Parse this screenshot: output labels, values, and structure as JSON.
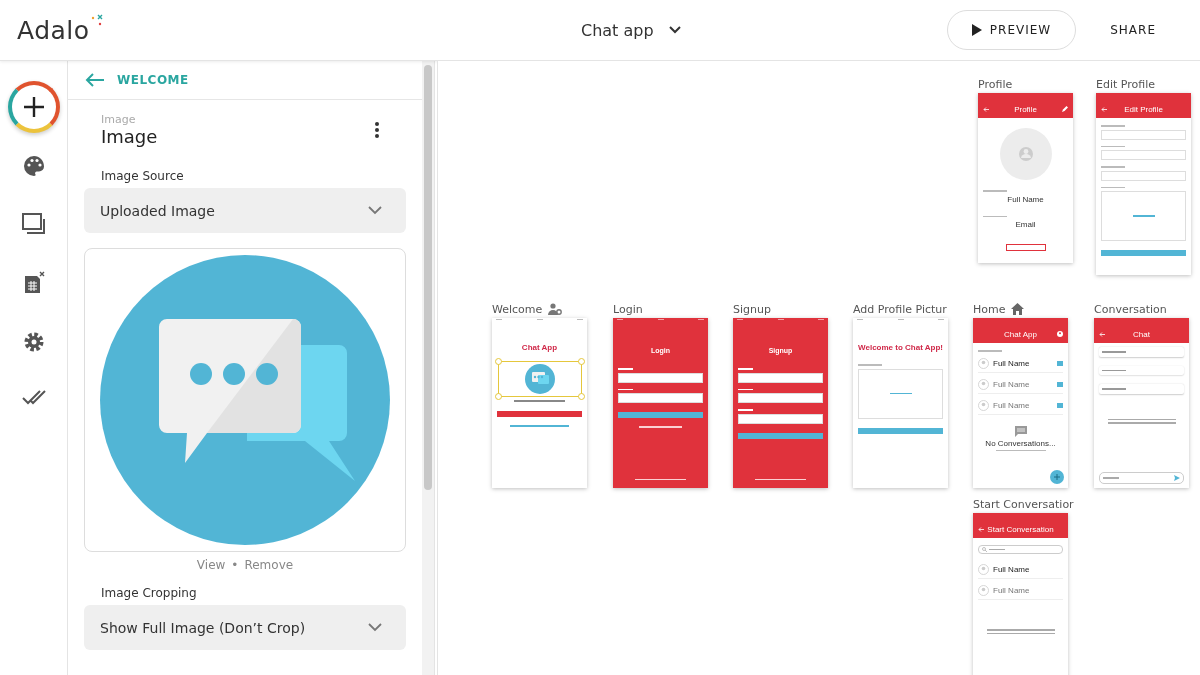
{
  "header": {
    "logo": "Adalo",
    "app_name": "Chat app",
    "preview": "PREVIEW",
    "share": "SHARE"
  },
  "panel": {
    "back": "WELCOME",
    "component_type": "Image",
    "component_name": "Image",
    "fields": [
      {
        "label": "Image Source",
        "value": "Uploaded Image"
      },
      {
        "label": "Image Cropping",
        "value": "Show Full Image (Don’t Crop)"
      }
    ],
    "image_links": [
      "View",
      "•",
      "Remove"
    ]
  },
  "screens": [
    {
      "title": "Profile",
      "kind": "white",
      "appbar": {
        "title": "Profile",
        "back": true,
        "kind": "edit"
      },
      "items": [
        {
          "kind": "avatar"
        },
        {
          "kind": "label"
        },
        {
          "kind": "value",
          "text": "Full Name"
        },
        {
          "kind": "label"
        },
        {
          "kind": "value",
          "text": "Email"
        },
        {
          "kind": "outline_button"
        }
      ]
    },
    {
      "title": "Edit Profile",
      "kind": "white",
      "appbar": {
        "title": "Edit Profile",
        "back": true,
        "kind": "plain"
      },
      "items": [
        {
          "kind": "label"
        },
        {
          "kind": "field"
        },
        {
          "kind": "label"
        },
        {
          "kind": "field"
        },
        {
          "kind": "label"
        },
        {
          "kind": "field"
        },
        {
          "kind": "label"
        },
        {
          "kind": "photo_box"
        },
        {
          "kind": "button"
        }
      ]
    },
    {
      "title": "Welcome",
      "kind": "white",
      "title_icon": {
        "kind": "person"
      },
      "items": [
        {
          "kind": "heading",
          "text": "Chat App"
        },
        {
          "kind": "image",
          "selected": true
        },
        {
          "kind": "caption"
        },
        {
          "kind": "button"
        },
        {
          "kind": "link"
        }
      ]
    },
    {
      "title": "Login",
      "kind": "red",
      "items": [
        {
          "kind": "heading",
          "text": "Login"
        },
        {
          "kind": "label"
        },
        {
          "kind": "field"
        },
        {
          "kind": "label"
        },
        {
          "kind": "field"
        },
        {
          "kind": "button"
        },
        {
          "kind": "link"
        },
        {
          "kind": "footer"
        }
      ]
    },
    {
      "title": "Signup",
      "kind": "red",
      "items": [
        {
          "kind": "heading",
          "text": "Signup"
        },
        {
          "kind": "label"
        },
        {
          "kind": "field"
        },
        {
          "kind": "label"
        },
        {
          "kind": "field"
        },
        {
          "kind": "label"
        },
        {
          "kind": "field"
        },
        {
          "kind": "button"
        },
        {
          "kind": "footer"
        }
      ]
    },
    {
      "title": "Add Profile Pictur",
      "kind": "white",
      "items": [
        {
          "kind": "heading",
          "text": "Welcome to Chat App!"
        },
        {
          "kind": "label"
        },
        {
          "kind": "photo_box"
        },
        {
          "kind": "button"
        }
      ]
    },
    {
      "title": "Home",
      "kind": "white",
      "title_icon": {
        "kind": "home"
      },
      "appbar": {
        "title": "Chat App",
        "back": false,
        "kind": "account"
      },
      "items": [
        {
          "kind": "label"
        },
        {
          "kind": "list_row",
          "text": "Full Name",
          "faded": false,
          "trailing": true
        },
        {
          "kind": "list_row",
          "text": "Full Name",
          "faded": true,
          "trailing": true
        },
        {
          "kind": "list_row",
          "text": "Full Name",
          "faded": true,
          "trailing": true
        },
        {
          "kind": "empty",
          "title": "No Conversations..."
        },
        {
          "kind": "fab"
        }
      ]
    },
    {
      "title": "Conversation",
      "kind": "white",
      "appbar": {
        "title": "Chat",
        "back": true,
        "kind": "plain"
      },
      "items": [
        {
          "kind": "message"
        },
        {
          "kind": "message"
        },
        {
          "kind": "message"
        },
        {
          "kind": "hint"
        },
        {
          "kind": "composer"
        }
      ]
    },
    {
      "title": "Start Conversatior",
      "kind": "white",
      "appbar": {
        "title": "Start Conversation",
        "back": true,
        "kind": "plain"
      },
      "items": [
        {
          "kind": "search"
        },
        {
          "kind": "list_row",
          "text": "Full Name",
          "faded": false,
          "trailing": false
        },
        {
          "kind": "list_row",
          "text": "Full Name",
          "faded": true,
          "trailing": false
        },
        {
          "kind": "hint"
        }
      ]
    }
  ]
}
